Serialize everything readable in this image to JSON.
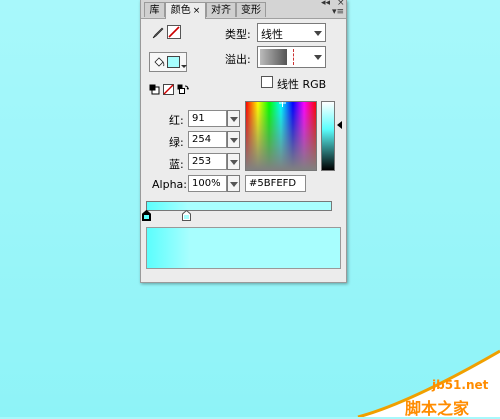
{
  "tabs": [
    {
      "label": "库",
      "active": false
    },
    {
      "label": "颜色",
      "active": true,
      "close": "×"
    },
    {
      "label": "对齐",
      "active": false
    },
    {
      "label": "变形",
      "active": false
    }
  ],
  "window_controls": {
    "collapse": "◂◂",
    "close": "×",
    "menu": "▾≡"
  },
  "type_row": {
    "label": "类型:",
    "value": "线性"
  },
  "overflow_row": {
    "label": "溢出:"
  },
  "linear_rgb": {
    "label": "线性 RGB",
    "checked": false
  },
  "channels": [
    {
      "label": "红:",
      "value": "91"
    },
    {
      "label": "绿:",
      "value": "254"
    },
    {
      "label": "蓝:",
      "value": "253"
    },
    {
      "label": "Alpha:",
      "value": "100%"
    }
  ],
  "hex": {
    "value": "#5BFEFD"
  },
  "colors": {
    "selected": "#5BFEFD",
    "stroke_none": "#cc0000"
  },
  "icons": [
    "pencil-icon",
    "paint-bucket-icon",
    "default-colors-icon",
    "no-color-icon",
    "swap-colors-icon"
  ],
  "watermark": {
    "domain": "jb51.net",
    "brand": "脚本之家"
  }
}
